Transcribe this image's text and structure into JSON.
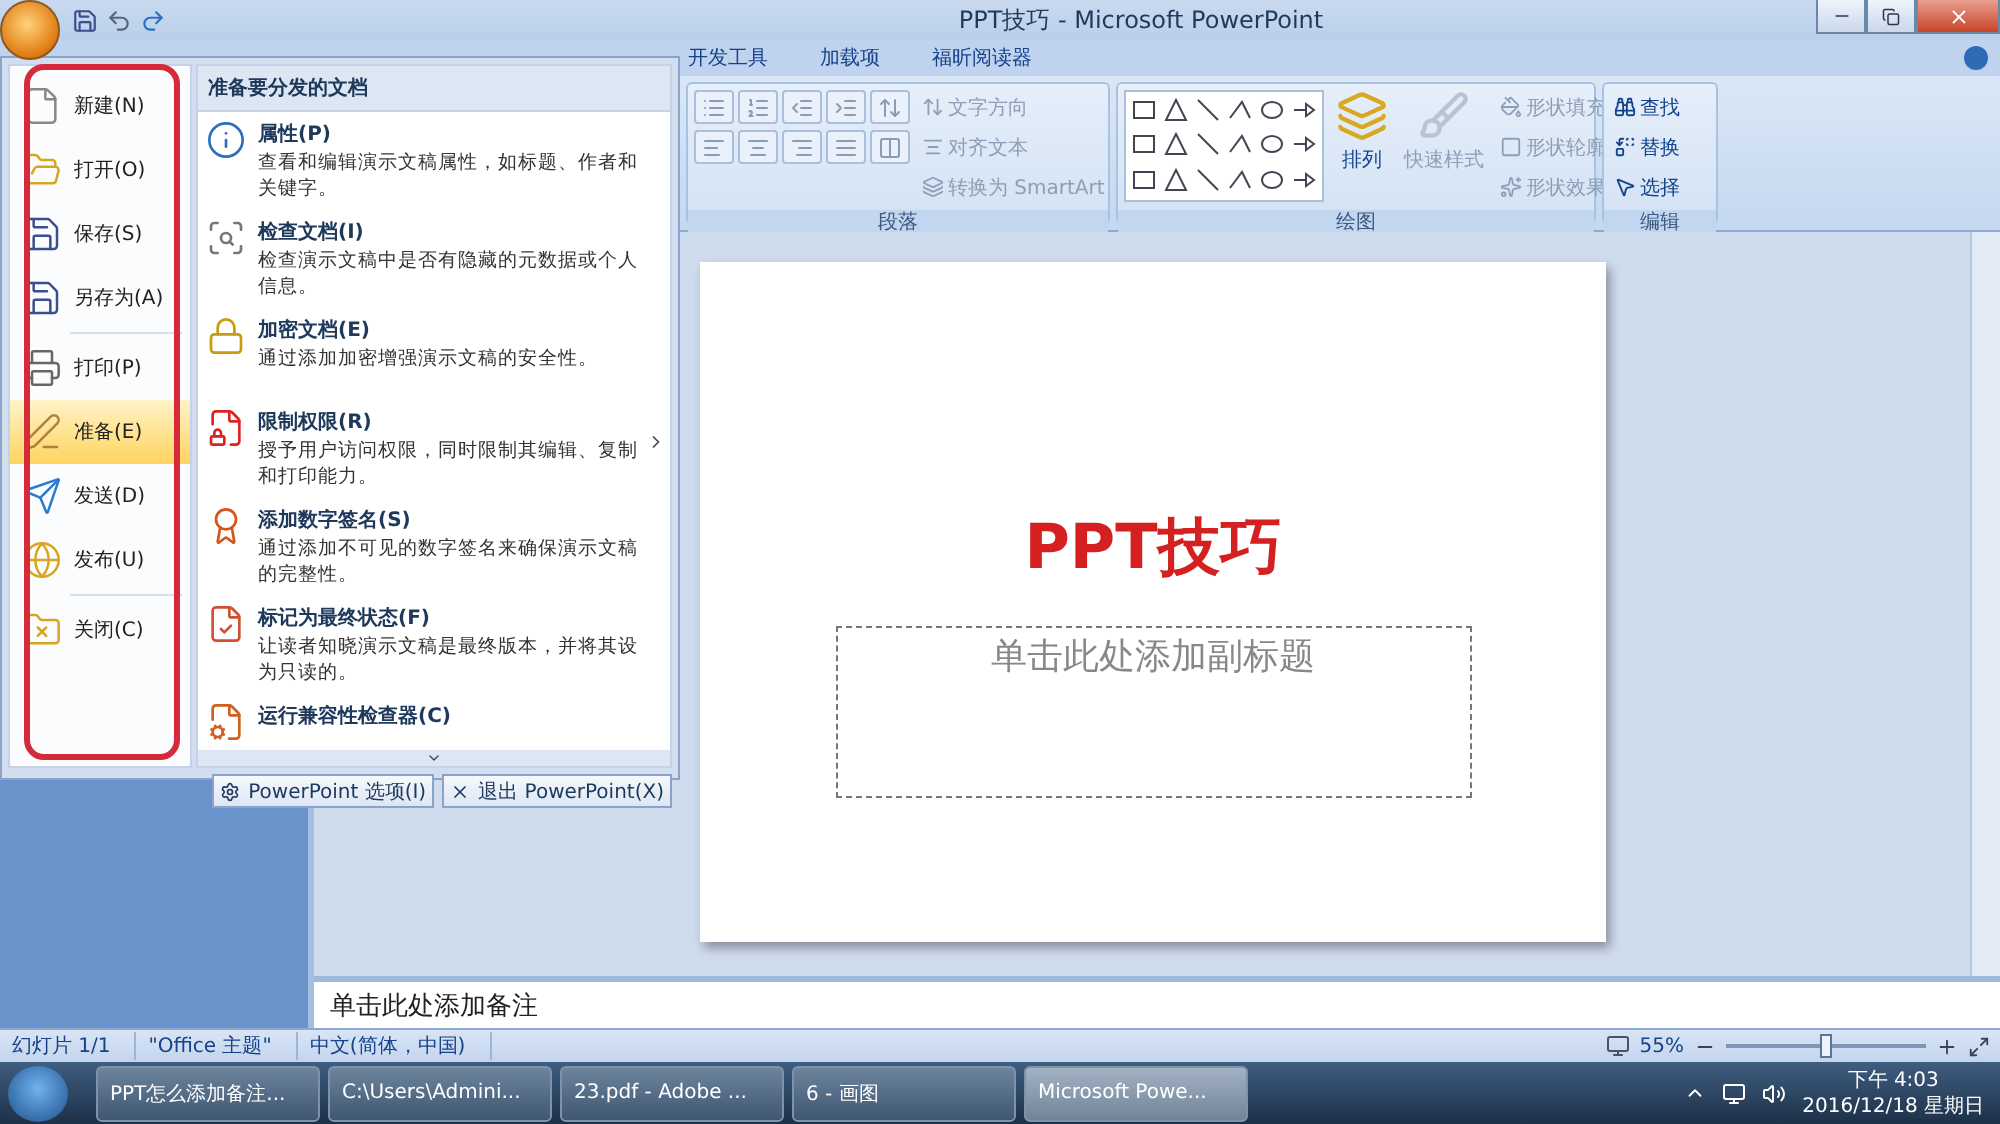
{
  "window": {
    "title": "PPT技巧 - Microsoft PowerPoint"
  },
  "ribbon_tabs": [
    {
      "label": "开发工具",
      "selected": false
    },
    {
      "label": "加载项",
      "selected": false
    },
    {
      "label": "福昕阅读器",
      "selected": false
    }
  ],
  "ribbon_groups": [
    {
      "kind": "paragraph",
      "label": "段落",
      "commands": [
        "文字方向",
        "对齐文本",
        "转换为 SmartArt"
      ]
    },
    {
      "kind": "drawing",
      "label": "绘图",
      "big_commands": [
        "排列",
        "快速样式"
      ],
      "commands": [
        "形状填充",
        "形状轮廓",
        "形状效果"
      ]
    },
    {
      "kind": "editing",
      "label": "编辑",
      "commands": [
        "查找",
        "替换",
        "选择"
      ]
    }
  ],
  "office_menu": {
    "left_groups": [
      [
        {
          "label": "新建(N)",
          "selected": false
        },
        {
          "label": "打开(O)",
          "selected": false
        },
        {
          "label": "保存(S)",
          "selected": false
        },
        {
          "label": "另存为(A)",
          "selected": false
        }
      ],
      [
        {
          "label": "打印(P)",
          "selected": false
        },
        {
          "label": "准备(E)",
          "selected": true
        },
        {
          "label": "发送(D)",
          "selected": false
        },
        {
          "label": "发布(U)",
          "selected": false
        }
      ],
      [
        {
          "label": "关闭(C)",
          "selected": false
        }
      ]
    ],
    "panel_title": "准备要分发的文档",
    "panel_items": [
      {
        "title": "属性(P)",
        "description": "查看和编辑演示文稿属性，如标题、作者和关键字。",
        "submenu": false
      },
      {
        "title": "检查文档(I)",
        "description": "检查演示文稿中是否有隐藏的元数据或个人信息。",
        "submenu": false
      },
      {
        "title": "加密文档(E)",
        "description": "通过添加加密增强演示文稿的安全性。",
        "submenu": false
      },
      {
        "title": "限制权限(R)",
        "description": "授予用户访问权限，同时限制其编辑、复制和打印能力。",
        "submenu": true
      },
      {
        "title": "添加数字签名(S)",
        "description": "通过添加不可见的数字签名来确保演示文稿的完整性。",
        "submenu": false
      },
      {
        "title": "标记为最终状态(F)",
        "description": "让读者知晓演示文稿是最终版本，并将其设为只读的。",
        "submenu": false
      },
      {
        "title": "运行兼容性检查器(C)",
        "submenu": false
      }
    ],
    "buttons": [
      "PowerPoint 选项(I)",
      "退出 PowerPoint(X)"
    ]
  },
  "slide": {
    "title": "PPT技巧",
    "subtitle_placeholder": "单击此处添加副标题"
  },
  "notes": {
    "placeholder": "单击此处添加备注"
  },
  "status_bar": {
    "items": [
      "幻灯片 1/1",
      "\"Office 主题\"",
      "中文(简体，中国)"
    ],
    "zoom": "55%",
    "zoom_slider": {
      "level": 0.5
    }
  },
  "taskbar": {
    "tasks": [
      {
        "label": "PPT怎么添加备注...",
        "selected": false
      },
      {
        "label": "C:\\Users\\Admini...",
        "selected": false
      },
      {
        "label": "23.pdf - Adobe ...",
        "selected": false
      },
      {
        "label": "6 - 画图",
        "selected": false
      },
      {
        "label": "Microsoft Powe...",
        "selected": true
      }
    ],
    "time": "下午 4:03",
    "date": "2016/12/18 星期日"
  }
}
